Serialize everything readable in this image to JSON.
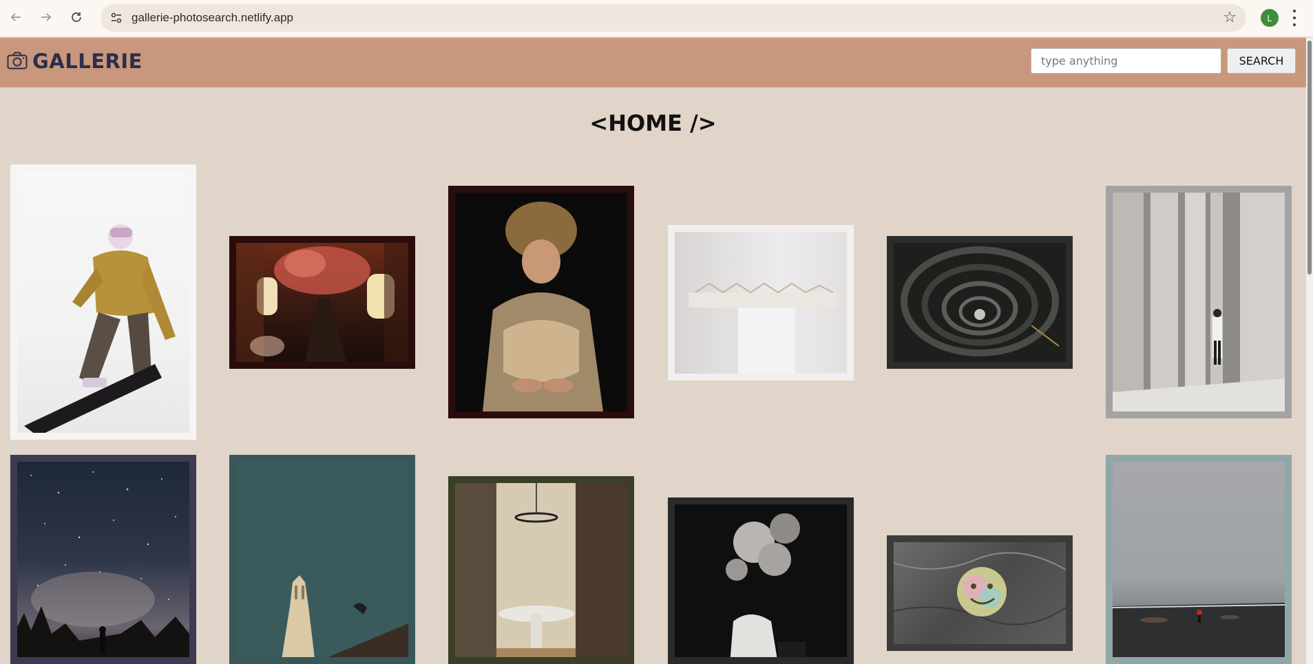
{
  "browser": {
    "url": "gallerie-photosearch.netlify.app",
    "profile_initial": "L",
    "icons": [
      "back-arrow-icon",
      "forward-arrow-icon",
      "reload-icon",
      "site-settings-icon",
      "star-icon",
      "kebab-menu-icon"
    ]
  },
  "header": {
    "logo_text": "GALLERIE",
    "logo_icon": "camera-icon",
    "background": "#c9977c",
    "search": {
      "placeholder": "type anything",
      "value": ""
    },
    "search_button": "SEARCH"
  },
  "page": {
    "title": "<HOME />"
  },
  "gallery": {
    "photos": [
      {
        "subject": "snowboarder in yellow jacket",
        "frame": "#f6f5f5"
      },
      {
        "subject": "alley with lanterns at night",
        "frame": "#2a0c0d"
      },
      {
        "subject": "person in fur coat and hat",
        "frame": "#2a0c0d"
      },
      {
        "subject": "architectural model on pedestal",
        "frame": "#f1efef"
      },
      {
        "subject": "spiral staircase",
        "frame": "#2b2c2c"
      },
      {
        "subject": "person walking through columns",
        "frame": "#a3a3a3"
      },
      {
        "subject": "starry night sky",
        "frame": "#3d3a52"
      },
      {
        "subject": "building against teal sky",
        "frame": "#395758"
      },
      {
        "subject": "dining room through doorway",
        "frame": "#3a3f26"
      },
      {
        "subject": "figure with balloon head",
        "frame": "#2a2a2a"
      },
      {
        "subject": "smiley sticker on wall",
        "frame": "#3c3c3c"
      },
      {
        "subject": "person on misty beach",
        "frame": "#8fa7a6"
      }
    ]
  }
}
